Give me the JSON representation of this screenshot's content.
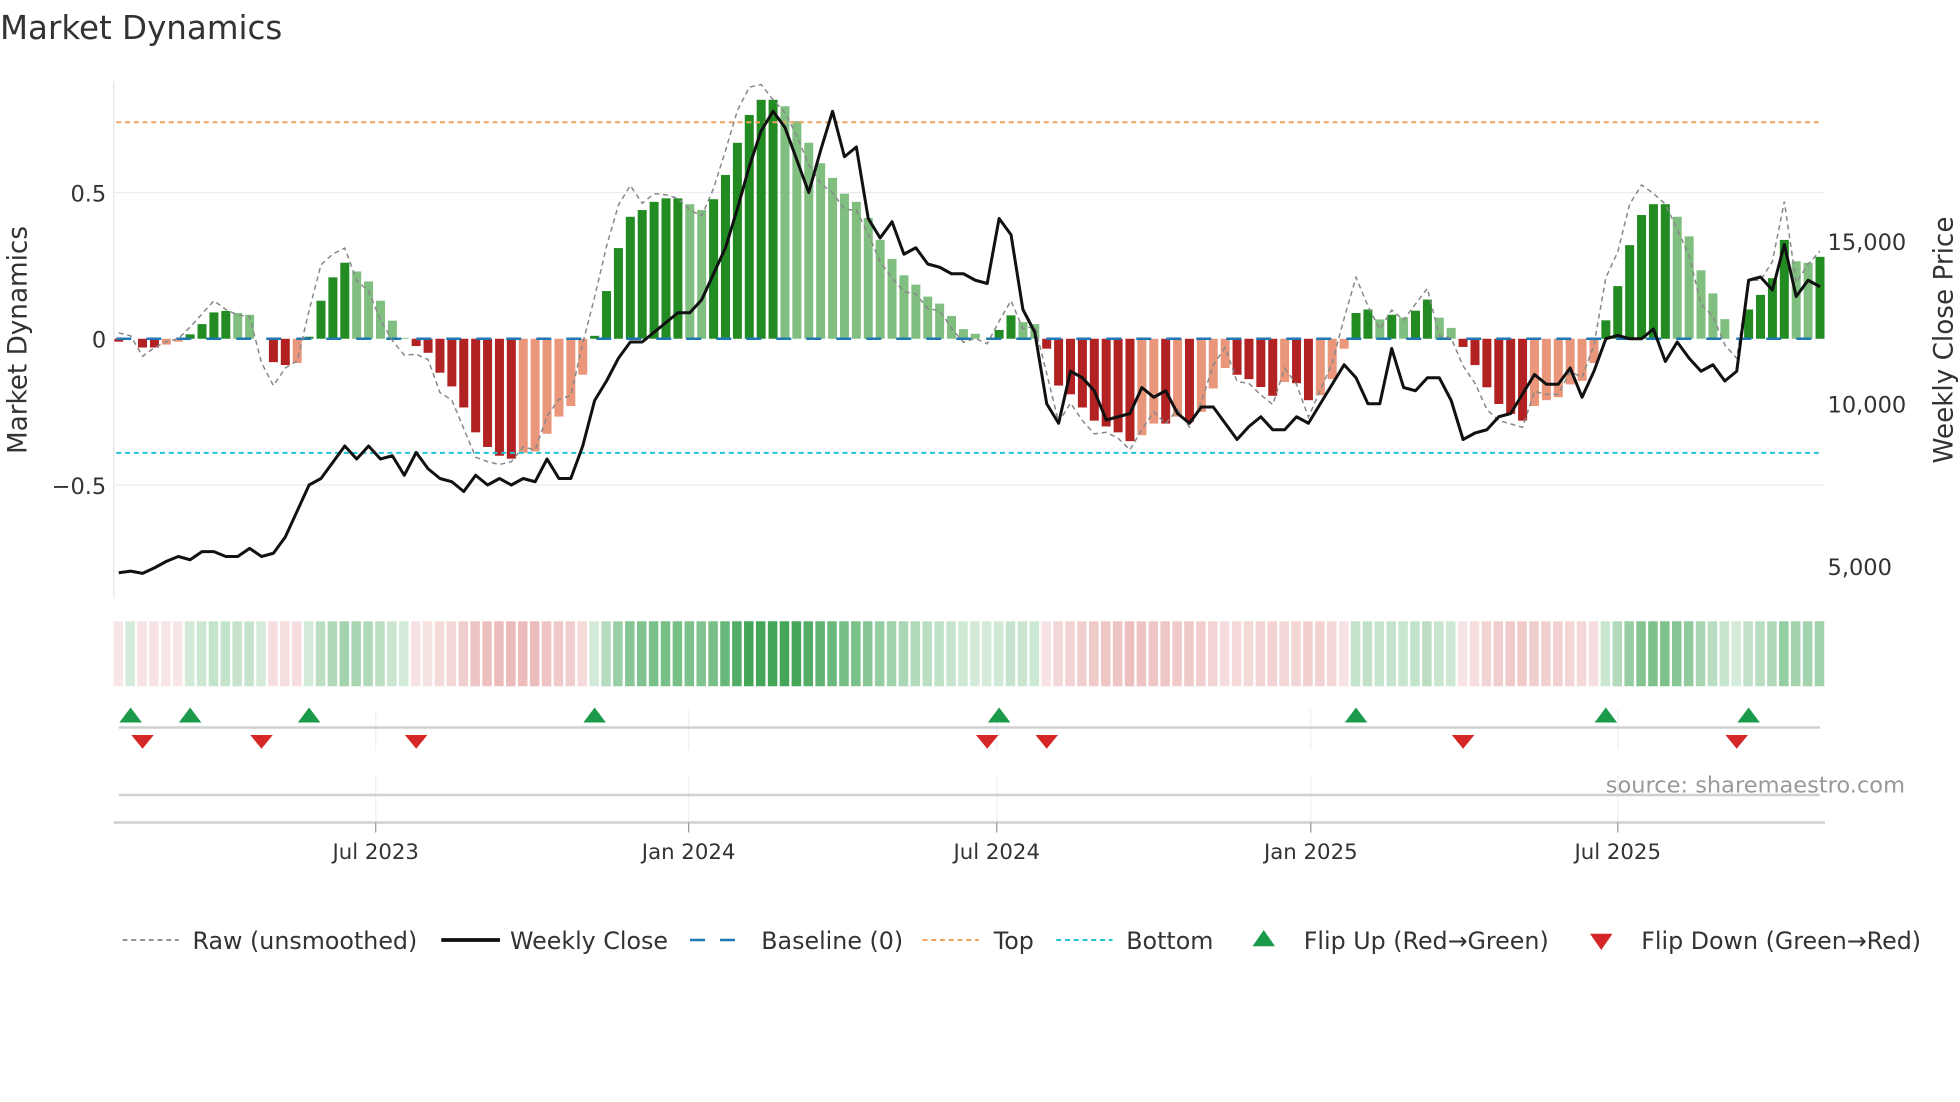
{
  "chart_data": {
    "type": "bar",
    "title": "Market Dynamics",
    "ylabel": "Market Dynamics",
    "y2label": "Weekly Close Price",
    "ylim": [
      -0.85,
      0.88
    ],
    "y2lim": [
      4500,
      19500
    ],
    "yticks": [
      {
        "v": 0.5,
        "label": "0.5"
      },
      {
        "v": 0,
        "label": "0"
      },
      {
        "v": -0.5,
        "label": "−0.5"
      }
    ],
    "y2ticks": [
      {
        "v": 15000,
        "label": "15,000"
      },
      {
        "v": 10000,
        "label": "10,000"
      },
      {
        "v": 5000,
        "label": "5,000"
      }
    ],
    "xticks": [
      {
        "week": 21.6,
        "label": "Jul 2023"
      },
      {
        "week": 47.9,
        "label": "Jan 2024"
      },
      {
        "week": 73.8,
        "label": "Jul 2024"
      },
      {
        "week": 100.2,
        "label": "Jan 2025"
      },
      {
        "week": 126,
        "label": "Jul 2025"
      }
    ],
    "top": 0.74,
    "bottom": -0.39,
    "baseline": 0,
    "values": [
      -0.01,
      0,
      -0.03,
      -0.03,
      -0.02,
      -0.01,
      0.015,
      0.05,
      0.09,
      0.095,
      0.088,
      0.082,
      0,
      -0.08,
      -0.09,
      -0.083,
      0.007,
      0.13,
      0.21,
      0.26,
      0.23,
      0.196,
      0.13,
      0.062,
      0.003,
      -0.025,
      -0.048,
      -0.116,
      -0.163,
      -0.235,
      -0.32,
      -0.37,
      -0.4,
      -0.41,
      -0.39,
      -0.385,
      -0.325,
      -0.266,
      -0.23,
      -0.123,
      0.01,
      0.163,
      0.31,
      0.417,
      0.44,
      0.468,
      0.48,
      0.48,
      0.46,
      0.44,
      0.477,
      0.56,
      0.67,
      0.765,
      0.817,
      0.817,
      0.795,
      0.744,
      0.67,
      0.6,
      0.55,
      0.496,
      0.468,
      0.413,
      0.338,
      0.273,
      0.217,
      0.185,
      0.144,
      0.12,
      0.078,
      0.033,
      0.017,
      0,
      0.03,
      0.08,
      0.057,
      0.05,
      -0.034,
      -0.16,
      -0.19,
      -0.235,
      -0.28,
      -0.3,
      -0.32,
      -0.35,
      -0.33,
      -0.29,
      -0.29,
      -0.266,
      -0.284,
      -0.25,
      -0.17,
      -0.1,
      -0.123,
      -0.138,
      -0.165,
      -0.195,
      -0.148,
      -0.152,
      -0.21,
      -0.193,
      -0.138,
      -0.034,
      0.088,
      0.1,
      0.066,
      0.082,
      0.073,
      0.096,
      0.134,
      0.072,
      0.037,
      -0.028,
      -0.09,
      -0.166,
      -0.223,
      -0.257,
      -0.28,
      -0.23,
      -0.21,
      -0.2,
      -0.156,
      -0.144,
      -0.083,
      0.063,
      0.18,
      0.32,
      0.423,
      0.46,
      0.46,
      0.417,
      0.35,
      0.234,
      0.155,
      0.067,
      0,
      0.1,
      0.15,
      0.207,
      0.338,
      0.265,
      0.26,
      0.28
    ],
    "raw": [
      0.02,
      0.01,
      -0.06,
      -0.03,
      -0.01,
      0,
      0.04,
      0.085,
      0.13,
      0.1,
      0.081,
      0.076,
      -0.082,
      -0.16,
      -0.1,
      -0.076,
      0.097,
      0.253,
      0.29,
      0.31,
      0.2,
      0.162,
      0.064,
      -0.006,
      -0.056,
      -0.053,
      -0.071,
      -0.184,
      -0.21,
      -0.307,
      -0.405,
      -0.42,
      -0.43,
      -0.42,
      -0.37,
      -0.38,
      -0.265,
      -0.207,
      -0.194,
      -0.016,
      0.143,
      0.316,
      0.457,
      0.524,
      0.463,
      0.496,
      0.492,
      0.48,
      0.44,
      0.42,
      0.514,
      0.643,
      0.78,
      0.86,
      0.869,
      0.817,
      0.773,
      0.693,
      0.596,
      0.53,
      0.5,
      0.442,
      0.44,
      0.358,
      0.263,
      0.208,
      0.161,
      0.153,
      0.103,
      0.096,
      0.036,
      -0.012,
      0.001,
      -0.017,
      0.06,
      0.13,
      0.034,
      0.043,
      -0.118,
      -0.286,
      -0.22,
      -0.28,
      -0.325,
      -0.32,
      -0.34,
      -0.38,
      -0.31,
      -0.25,
      -0.29,
      -0.242,
      -0.302,
      -0.216,
      -0.09,
      -0.03,
      -0.146,
      -0.153,
      -0.192,
      -0.225,
      -0.101,
      -0.156,
      -0.268,
      -0.176,
      -0.083,
      0.07,
      0.21,
      0.112,
      0.032,
      0.098,
      0.064,
      0.119,
      0.172,
      0.01,
      0.002,
      -0.093,
      -0.152,
      -0.242,
      -0.28,
      -0.291,
      -0.303,
      -0.18,
      -0.19,
      -0.19,
      -0.112,
      -0.132,
      -0.022,
      0.209,
      0.297,
      0.46,
      0.526,
      0.497,
      0.46,
      0.374,
      0.283,
      0.118,
      0.076,
      -0.021,
      -0.067,
      0.2,
      0.2,
      0.264,
      0.469,
      0.192,
      0.255,
      0.3
    ],
    "weekly_close": [
      4800,
      4850,
      4780,
      4950,
      5150,
      5300,
      5200,
      5450,
      5450,
      5300,
      5300,
      5550,
      5300,
      5400,
      5900,
      6700,
      7500,
      7700,
      8200,
      8700,
      8300,
      8700,
      8300,
      8400,
      7800,
      8500,
      8000,
      7700,
      7600,
      7300,
      7800,
      7500,
      7700,
      7500,
      7700,
      7600,
      8300,
      7700,
      7700,
      8700,
      10100,
      10700,
      11400,
      11900,
      11900,
      12200,
      12500,
      12800,
      12800,
      13200,
      14000,
      14800,
      16000,
      17300,
      18400,
      19000,
      18500,
      17500,
      16500,
      17800,
      19000,
      17600,
      17900,
      15700,
      15100,
      15600,
      14600,
      14800,
      14300,
      14200,
      14000,
      14000,
      13800,
      13700,
      15700,
      15200,
      12900,
      12200,
      10000,
      9400,
      11000,
      10800,
      10400,
      9500,
      9600,
      9700,
      10500,
      10200,
      10400,
      9700,
      9400,
      9900,
      9900,
      9400,
      8900,
      9300,
      9600,
      9200,
      9200,
      9600,
      9400,
      10000,
      10600,
      11200,
      10800,
      10000,
      10000,
      11700,
      10500,
      10400,
      10800,
      10800,
      10100,
      8900,
      9100,
      9200,
      9600,
      9700,
      10300,
      10900,
      10600,
      10600,
      11100,
      10200,
      11000,
      12000,
      12100,
      12000,
      12000,
      12300,
      11300,
      11900,
      11400,
      11000,
      11200,
      10700,
      11000,
      13800,
      13900,
      13500,
      14900,
      13300,
      13800,
      13600
    ],
    "flip_up_weeks": [
      1,
      6,
      16,
      40,
      74,
      104,
      125,
      137
    ],
    "flip_down_weeks": [
      2,
      12,
      25,
      73,
      78,
      113,
      136
    ],
    "legend": {
      "placement": "bottom",
      "items": [
        "Raw (unsmoothed)",
        "Weekly Close",
        "Baseline (0)",
        "Top",
        "Bottom",
        "Flip Up (Red→Green)",
        "Flip Down (Green→Red)"
      ]
    },
    "source": "source: sharemaestro.com",
    "colors": {
      "up_strong": "#228b22",
      "up_weak": "#80bf80",
      "down_strong": "#b22222",
      "down_weak": "#e9967a",
      "top": "#f0a35e",
      "bottom": "#22c4d6",
      "baseline": "#1f77b4",
      "close": "#111111",
      "raw": "#888888",
      "flip_up": "#1a9a4a",
      "flip_down": "#d62728"
    }
  }
}
